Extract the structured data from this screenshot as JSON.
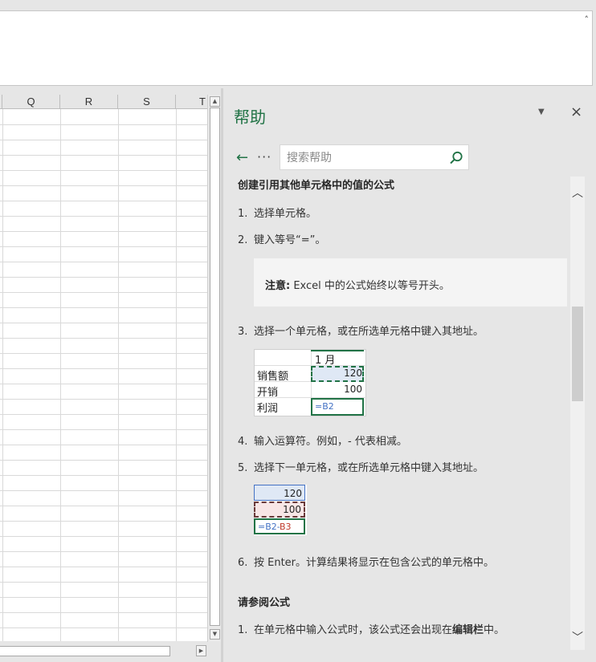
{
  "formula_bar": {
    "collapse_icon": "caret-up-icon"
  },
  "sheet": {
    "columns": [
      "Q",
      "R",
      "S",
      "T"
    ],
    "row_count": 34
  },
  "help": {
    "title": "帮助",
    "search_placeholder": "搜索帮助",
    "back_glyph": "←",
    "more_glyph": "···",
    "close_glyph": "×",
    "menu_glyph": "▼",
    "section1_title": "创建引用其他单元格中的值的公式",
    "steps": [
      {
        "num": "1.",
        "text": "选择单元格。"
      },
      {
        "num": "2.",
        "text": "键入等号“=”。"
      },
      {
        "num": "3.",
        "text": "选择一个单元格，或在所选单元格中键入其地址。"
      },
      {
        "num": "4.",
        "text": "输入运算符。例如，- 代表相减。"
      },
      {
        "num": "5.",
        "text": "选择下一单元格，或在所选单元格中键入其地址。"
      },
      {
        "num": "6.",
        "text": "按 Enter。计算结果将显示在包含公式的单元格中。"
      }
    ],
    "note_label": "注意:",
    "note_text": " Excel 中的公式始终以等号开头。",
    "example1": {
      "header": "1 月",
      "rows": [
        {
          "label": "销售额",
          "value": "120"
        },
        {
          "label": "开销",
          "value": "100"
        },
        {
          "label": "利润",
          "value": "=B2"
        }
      ]
    },
    "example2": {
      "values": [
        "120",
        "100"
      ],
      "formula_a": "=B2-",
      "formula_b": "B3"
    },
    "section2_title": "请参阅公式",
    "see_also": [
      {
        "num": "1.",
        "text_a": "在单元格中输入公式时，该公式还会出现在",
        "text_b": "编辑栏",
        "text_c": "中。"
      }
    ]
  },
  "colors": {
    "accent": "#217346",
    "ref_blue": "#4472c4",
    "ref_red": "#c0392b"
  }
}
